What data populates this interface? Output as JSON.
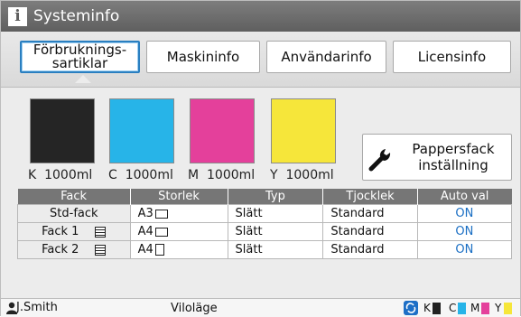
{
  "window": {
    "title": "Systeminfo"
  },
  "tabs": [
    {
      "label_line1": "Förbruknings-",
      "label_line2": "sartiklar",
      "active": true
    },
    {
      "label": "Maskininfo"
    },
    {
      "label": "Användarinfo"
    },
    {
      "label": "Licensinfo"
    }
  ],
  "inks": [
    {
      "letter": "K",
      "amount": "1000ml",
      "color": "#252525"
    },
    {
      "letter": "C",
      "amount": "1000ml",
      "color": "#27b4e8"
    },
    {
      "letter": "M",
      "amount": "1000ml",
      "color": "#e4409b"
    },
    {
      "letter": "Y",
      "amount": "1000ml",
      "color": "#f6e63a"
    }
  ],
  "paper_button": {
    "line1": "Pappersfack",
    "line2": "inställning"
  },
  "table": {
    "headers": [
      "Fack",
      "Storlek",
      "Typ",
      "Tjocklek",
      "Auto val"
    ],
    "rows": [
      {
        "fack": "Std-fack",
        "size": "A3",
        "type": "Slätt",
        "thickness": "Standard",
        "auto": "ON"
      },
      {
        "fack": "Fack 1",
        "size": "A4",
        "type": "Slätt",
        "thickness": "Standard",
        "auto": "ON"
      },
      {
        "fack": "Fack 2",
        "size": "A4",
        "type": "Slätt",
        "thickness": "Standard",
        "auto": "ON"
      }
    ]
  },
  "status": {
    "user": "J.Smith",
    "mode": "Viloläge",
    "ink_letters": [
      "K",
      "C",
      "M",
      "Y"
    ]
  }
}
